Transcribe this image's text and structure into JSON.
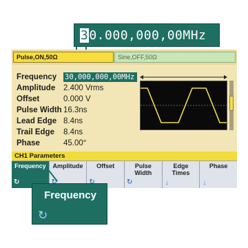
{
  "zoom_frequency": {
    "cursor_digit": "3",
    "rest": "0.000,000,00MHz"
  },
  "tabs": {
    "ch1": "Pulse,ON,50Ω",
    "ch2": "Sine,OFF,50Ω"
  },
  "params": [
    {
      "label": "Frequency",
      "value": "30,000,000,00MHz",
      "selected": true
    },
    {
      "label": "Amplitude",
      "value": "2.400 Vrms"
    },
    {
      "label": "Offset",
      "value": "0.000 V"
    },
    {
      "label": "Pulse Width",
      "value": "16.3ns"
    },
    {
      "label": "Lead Edge",
      "value": "8.4ns"
    },
    {
      "label": "Trail Edge",
      "value": "8.4ns"
    },
    {
      "label": "Phase",
      "value": "45.00°"
    }
  ],
  "channel_params_title": "CH1 Parameters",
  "softkeys": [
    {
      "label": "Frequency",
      "active": true,
      "icon": "knob-icon"
    },
    {
      "label": "Amplitude",
      "icon": "knob-icon"
    },
    {
      "label": "Offset",
      "icon": "knob-icon"
    },
    {
      "label": "Pulse\nWidth",
      "icon": "knob-icon"
    },
    {
      "label": "Edge\nTimes",
      "icon": "down-arrow-icon"
    },
    {
      "label": "Phase",
      "icon": "down-arrow-icon"
    }
  ],
  "zoom_key_label": "Frequency",
  "colors": {
    "accent": "#1e6f62",
    "screen_bg": "#f3e6b6",
    "ch1_tab": "#f8dd3e",
    "wave": "#f2e04a"
  }
}
